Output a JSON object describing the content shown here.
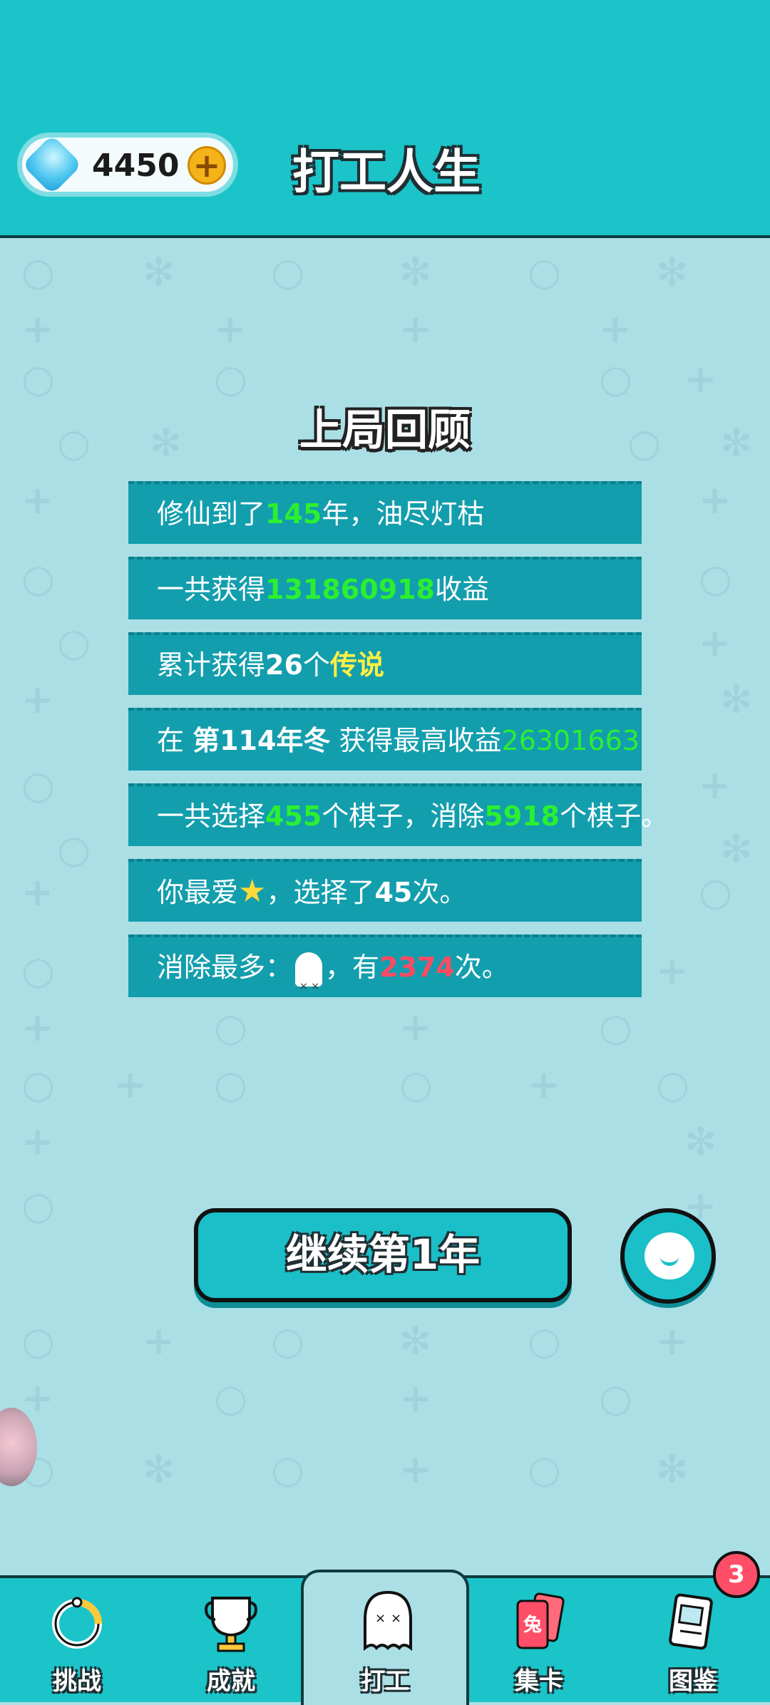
{
  "header": {
    "gem_count": "4450",
    "title": "打工人生"
  },
  "review": {
    "title": "上局回顾",
    "rows": [
      {
        "t1": "修仙到了",
        "v1": "145",
        "t2": "年，油尽灯枯"
      },
      {
        "t1": "一共获得",
        "v1": "131860918",
        "t2": "收益"
      },
      {
        "t1": "累计获得",
        "v1": "26",
        "t2": "个",
        "v2": "传说"
      },
      {
        "t1": "在 ",
        "v1": "第114年冬",
        "t2": " 获得最高收益",
        "v2": "26301663"
      },
      {
        "t1": "一共选择",
        "v1": "455",
        "t2": "个棋子，消除",
        "v2": "5918",
        "t3": "个棋子。"
      },
      {
        "t1": "你最爱",
        "icon": "star-icon",
        "t2": "，选择了",
        "v1": "45",
        "t3": "次。"
      },
      {
        "t1": "消除最多：",
        "icon": "ghost-icon",
        "t2": "，有",
        "v1": "2374",
        "t3": "次。"
      }
    ]
  },
  "actions": {
    "continue_label": "继续第1年",
    "chat_icon": "chat-bubble-icon"
  },
  "nav": {
    "items": [
      {
        "label": "挑战",
        "icon": "challenge-icon"
      },
      {
        "label": "成就",
        "icon": "trophy-icon"
      },
      {
        "label": "打工",
        "icon": "ghost-icon"
      },
      {
        "label": "集卡",
        "icon": "card-icon"
      },
      {
        "label": "图鉴",
        "icon": "book-icon",
        "badge": "3"
      }
    ]
  },
  "colors": {
    "header_bg": "#1AC4C8",
    "page_bg": "#ABDFE6",
    "row_bg": "#139EAD",
    "highlight_green": "#2BEF31",
    "highlight_yellow": "#FFF044",
    "highlight_red": "#FF4B62",
    "badge": "#FF4E68"
  }
}
